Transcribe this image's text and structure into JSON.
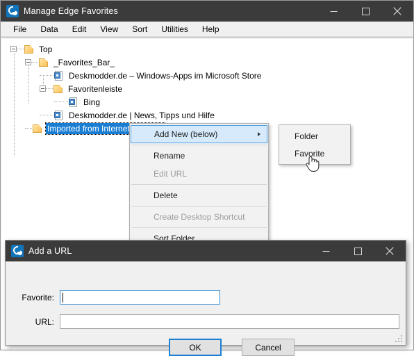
{
  "main_window": {
    "title": "Manage Edge Favorites",
    "icon": "edge-logo-icon",
    "controls": {
      "minimize": "minimize-icon",
      "maximize": "maximize-icon",
      "close": "close-icon"
    },
    "menubar": [
      {
        "label": "File"
      },
      {
        "label": "Data"
      },
      {
        "label": "Edit"
      },
      {
        "label": "View"
      },
      {
        "label": "Sort"
      },
      {
        "label": "Utilities"
      },
      {
        "label": "Help"
      }
    ]
  },
  "tree": {
    "nodes": [
      {
        "label": "Top",
        "type": "folder",
        "depth": 0,
        "expander": "collapse",
        "selected": false
      },
      {
        "label": "_Favorites_Bar_",
        "type": "folder",
        "depth": 1,
        "expander": "collapse",
        "selected": false
      },
      {
        "label": "Deskmodder.de – Windows-Apps im Microsoft Store",
        "type": "shortcut",
        "depth": 2,
        "expander": "none",
        "selected": false
      },
      {
        "label": "Favoritenleiste",
        "type": "folder",
        "depth": 2,
        "expander": "collapse",
        "selected": false
      },
      {
        "label": "Bing",
        "type": "shortcut",
        "depth": 3,
        "expander": "none",
        "selected": false
      },
      {
        "label": "Deskmodder.de | News, Tipps und Hilfe",
        "type": "shortcut",
        "depth": 2,
        "expander": "none",
        "selected": false
      },
      {
        "label": "Imported from Internet Explorer",
        "type": "folder",
        "depth": 1,
        "expander": "none",
        "selected": true
      }
    ]
  },
  "context_menu": {
    "items": [
      {
        "label": "Add New (below)",
        "state": "highlighted",
        "submenu": true
      },
      {
        "label": "Rename",
        "state": "normal",
        "submenu": false
      },
      {
        "label": "Edit URL",
        "state": "disabled",
        "submenu": false
      },
      {
        "label": "Delete",
        "state": "normal",
        "submenu": false
      },
      {
        "label": "Create Desktop Shortcut",
        "state": "disabled",
        "submenu": false
      },
      {
        "label": "Sort Folder",
        "state": "normal",
        "submenu": false
      }
    ]
  },
  "sub_menu": {
    "items": [
      {
        "label": "Folder"
      },
      {
        "label": "Favorite"
      }
    ]
  },
  "dialog": {
    "title": "Add a URL",
    "icon": "edge-logo-icon",
    "controls": {
      "minimize": "minimize-icon",
      "maximize": "maximize-icon",
      "close": "close-icon"
    },
    "fields": [
      {
        "label": "Favorite:",
        "value": "",
        "focused": true
      },
      {
        "label": "URL:",
        "value": "",
        "focused": false
      }
    ],
    "buttons": [
      {
        "label": "OK",
        "default": true
      },
      {
        "label": "Cancel",
        "default": false
      }
    ]
  },
  "colors": {
    "titlebar": "#3b3b3b",
    "window_bg": "#f0f0f0",
    "selection": "#1a7fd4",
    "menu_highlight": "#d6eafc",
    "accent_border": "#4c9fe0",
    "focus_blue": "#1b7fd4",
    "folder": "#ffd27a"
  }
}
